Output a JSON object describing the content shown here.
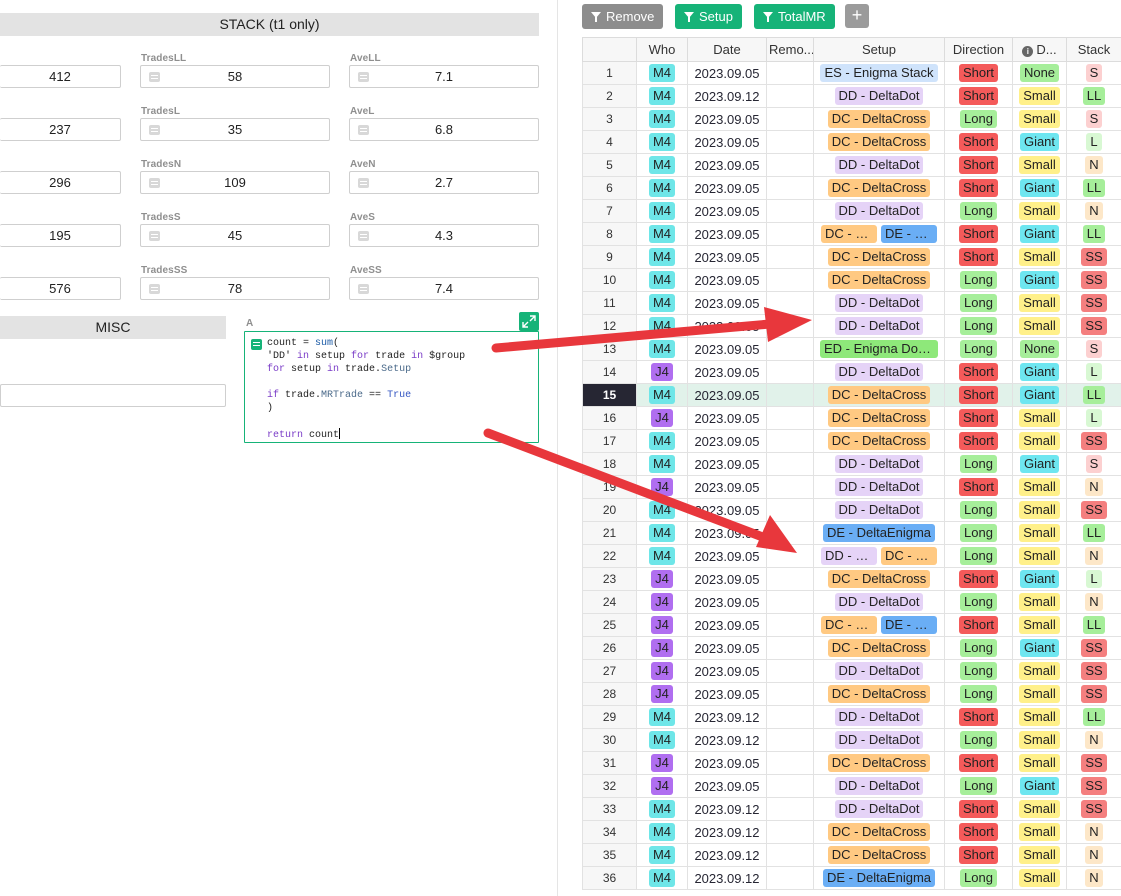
{
  "stack_section": {
    "title": "STACK   (t1 only)",
    "left_values": [
      "412",
      "237",
      "296",
      "195",
      "576"
    ],
    "fields": [
      {
        "label": "TradesLL",
        "value": "58"
      },
      {
        "label": "AveLL",
        "value": "7.1"
      },
      {
        "label": "TradesL",
        "value": "35"
      },
      {
        "label": "AveL",
        "value": "6.8"
      },
      {
        "label": "TradesN",
        "value": "109"
      },
      {
        "label": "AveN",
        "value": "2.7"
      },
      {
        "label": "TradesS",
        "value": "45"
      },
      {
        "label": "AveS",
        "value": "4.3"
      },
      {
        "label": "TradesSS",
        "value": "78"
      },
      {
        "label": "AveSS",
        "value": "7.4"
      }
    ]
  },
  "misc_section": {
    "title": "MISC"
  },
  "formula_editor": {
    "column_label": "A",
    "code": "count = sum(\n'DD' in setup for trade in $group\nfor setup in trade.Setup\n\nif trade.MRTrade == True\n)\n\nreturn count"
  },
  "filters": [
    {
      "label": "Remove",
      "color": "#8d8d8d"
    },
    {
      "label": "Setup",
      "color": "#16b378"
    },
    {
      "label": "TotalMR",
      "color": "#16b378"
    }
  ],
  "grid": {
    "columns": [
      "",
      "Who",
      "Date",
      "Remo...",
      "Setup",
      "Direction",
      "D...",
      "Stack"
    ],
    "selected_row": 15,
    "chip_colors": {
      "M4": "#6ee6e8",
      "J4": "#b06ef0",
      "ES": "#cfe3fb",
      "DD": "#e5d3f7",
      "DC": "#ffc982",
      "DE": "#6aaef5",
      "ED": "#8ee87a",
      "Short": "#f45a5a",
      "Long": "#a6ee9a",
      "None": "#a6ee9a",
      "Small": "#fff08a",
      "Giant": "#6ee6f0",
      "S": "#fcd0d0",
      "LL": "#a6ee9a",
      "N": "#fde7c8",
      "L": "#d8f8d3",
      "SS": "#f47f7f"
    },
    "rows": [
      {
        "n": "1",
        "who": "M4",
        "date": "2023.09.05",
        "setup": [
          {
            "k": "ES",
            "t": "ES - Enigma Stack"
          }
        ],
        "dir": "Short",
        "d": "None",
        "stack": "S"
      },
      {
        "n": "2",
        "who": "M4",
        "date": "2023.09.12",
        "setup": [
          {
            "k": "DD",
            "t": "DD - DeltaDot"
          }
        ],
        "dir": "Short",
        "d": "Small",
        "stack": "LL"
      },
      {
        "n": "3",
        "who": "M4",
        "date": "2023.09.05",
        "setup": [
          {
            "k": "DC",
            "t": "DC - DeltaCross"
          }
        ],
        "dir": "Long",
        "d": "Small",
        "stack": "S"
      },
      {
        "n": "4",
        "who": "M4",
        "date": "2023.09.05",
        "setup": [
          {
            "k": "DC",
            "t": "DC - DeltaCross"
          }
        ],
        "dir": "Short",
        "d": "Giant",
        "stack": "L"
      },
      {
        "n": "5",
        "who": "M4",
        "date": "2023.09.05",
        "setup": [
          {
            "k": "DD",
            "t": "DD - DeltaDot"
          }
        ],
        "dir": "Short",
        "d": "Small",
        "stack": "N"
      },
      {
        "n": "6",
        "who": "M4",
        "date": "2023.09.05",
        "setup": [
          {
            "k": "DC",
            "t": "DC - DeltaCross"
          }
        ],
        "dir": "Short",
        "d": "Giant",
        "stack": "LL"
      },
      {
        "n": "7",
        "who": "M4",
        "date": "2023.09.05",
        "setup": [
          {
            "k": "DD",
            "t": "DD - DeltaDot"
          }
        ],
        "dir": "Long",
        "d": "Small",
        "stack": "N"
      },
      {
        "n": "8",
        "who": "M4",
        "date": "2023.09.05",
        "setup": [
          {
            "k": "DC",
            "t": "DC - DeltaCross"
          },
          {
            "k": "DE",
            "t": "DE - DeltaEnigma"
          }
        ],
        "dir": "Short",
        "d": "Giant",
        "stack": "LL"
      },
      {
        "n": "9",
        "who": "M4",
        "date": "2023.09.05",
        "setup": [
          {
            "k": "DC",
            "t": "DC - DeltaCross"
          }
        ],
        "dir": "Short",
        "d": "Small",
        "stack": "SS"
      },
      {
        "n": "10",
        "who": "M4",
        "date": "2023.09.05",
        "setup": [
          {
            "k": "DC",
            "t": "DC - DeltaCross"
          }
        ],
        "dir": "Long",
        "d": "Giant",
        "stack": "SS"
      },
      {
        "n": "11",
        "who": "M4",
        "date": "2023.09.05",
        "setup": [
          {
            "k": "DD",
            "t": "DD - DeltaDot"
          }
        ],
        "dir": "Long",
        "d": "Small",
        "stack": "SS"
      },
      {
        "n": "12",
        "who": "M4",
        "date": "2023.09.05",
        "setup": [
          {
            "k": "DD",
            "t": "DD - DeltaDot"
          }
        ],
        "dir": "Long",
        "d": "Small",
        "stack": "SS"
      },
      {
        "n": "13",
        "who": "M4",
        "date": "2023.09.05",
        "setup": [
          {
            "k": "ED",
            "t": "ED - Enigma DotCross"
          }
        ],
        "dir": "Long",
        "d": "None",
        "stack": "S"
      },
      {
        "n": "14",
        "who": "J4",
        "date": "2023.09.05",
        "setup": [
          {
            "k": "DD",
            "t": "DD - DeltaDot"
          }
        ],
        "dir": "Short",
        "d": "Giant",
        "stack": "L"
      },
      {
        "n": "15",
        "who": "M4",
        "date": "2023.09.05",
        "setup": [
          {
            "k": "DC",
            "t": "DC - DeltaCross"
          }
        ],
        "dir": "Short",
        "d": "Giant",
        "stack": "LL"
      },
      {
        "n": "16",
        "who": "J4",
        "date": "2023.09.05",
        "setup": [
          {
            "k": "DC",
            "t": "DC - DeltaCross"
          }
        ],
        "dir": "Short",
        "d": "Small",
        "stack": "L"
      },
      {
        "n": "17",
        "who": "M4",
        "date": "2023.09.05",
        "setup": [
          {
            "k": "DC",
            "t": "DC - DeltaCross"
          }
        ],
        "dir": "Short",
        "d": "Small",
        "stack": "SS"
      },
      {
        "n": "18",
        "who": "M4",
        "date": "2023.09.05",
        "setup": [
          {
            "k": "DD",
            "t": "DD - DeltaDot"
          }
        ],
        "dir": "Long",
        "d": "Giant",
        "stack": "S"
      },
      {
        "n": "19",
        "who": "J4",
        "date": "2023.09.05",
        "setup": [
          {
            "k": "DD",
            "t": "DD - DeltaDot"
          }
        ],
        "dir": "Short",
        "d": "Small",
        "stack": "N"
      },
      {
        "n": "20",
        "who": "M4",
        "date": "2023.09.05",
        "setup": [
          {
            "k": "DD",
            "t": "DD - DeltaDot"
          }
        ],
        "dir": "Long",
        "d": "Small",
        "stack": "SS"
      },
      {
        "n": "21",
        "who": "M4",
        "date": "2023.09.05",
        "setup": [
          {
            "k": "DE",
            "t": "DE - DeltaEnigma"
          }
        ],
        "dir": "Long",
        "d": "Small",
        "stack": "LL"
      },
      {
        "n": "22",
        "who": "M4",
        "date": "2023.09.05",
        "setup": [
          {
            "k": "DD",
            "t": "DD - DeltaDot"
          },
          {
            "k": "DC",
            "t": "DC - DeltaCross"
          }
        ],
        "dir": "Long",
        "d": "Small",
        "stack": "N"
      },
      {
        "n": "23",
        "who": "J4",
        "date": "2023.09.05",
        "setup": [
          {
            "k": "DC",
            "t": "DC - DeltaCross"
          }
        ],
        "dir": "Short",
        "d": "Giant",
        "stack": "L"
      },
      {
        "n": "24",
        "who": "J4",
        "date": "2023.09.05",
        "setup": [
          {
            "k": "DD",
            "t": "DD - DeltaDot"
          }
        ],
        "dir": "Long",
        "d": "Small",
        "stack": "N"
      },
      {
        "n": "25",
        "who": "J4",
        "date": "2023.09.05",
        "setup": [
          {
            "k": "DC",
            "t": "DC - DeltaCross"
          },
          {
            "k": "DE",
            "t": "DE - DeltaEnigma"
          }
        ],
        "dir": "Short",
        "d": "Small",
        "stack": "LL"
      },
      {
        "n": "26",
        "who": "J4",
        "date": "2023.09.05",
        "setup": [
          {
            "k": "DC",
            "t": "DC - DeltaCross"
          }
        ],
        "dir": "Long",
        "d": "Giant",
        "stack": "SS"
      },
      {
        "n": "27",
        "who": "J4",
        "date": "2023.09.05",
        "setup": [
          {
            "k": "DD",
            "t": "DD - DeltaDot"
          }
        ],
        "dir": "Long",
        "d": "Small",
        "stack": "SS"
      },
      {
        "n": "28",
        "who": "J4",
        "date": "2023.09.05",
        "setup": [
          {
            "k": "DC",
            "t": "DC - DeltaCross"
          }
        ],
        "dir": "Long",
        "d": "Small",
        "stack": "SS"
      },
      {
        "n": "29",
        "who": "M4",
        "date": "2023.09.12",
        "setup": [
          {
            "k": "DD",
            "t": "DD - DeltaDot"
          }
        ],
        "dir": "Short",
        "d": "Small",
        "stack": "LL"
      },
      {
        "n": "30",
        "who": "M4",
        "date": "2023.09.12",
        "setup": [
          {
            "k": "DD",
            "t": "DD - DeltaDot"
          }
        ],
        "dir": "Long",
        "d": "Small",
        "stack": "N"
      },
      {
        "n": "31",
        "who": "J4",
        "date": "2023.09.05",
        "setup": [
          {
            "k": "DC",
            "t": "DC - DeltaCross"
          }
        ],
        "dir": "Short",
        "d": "Small",
        "stack": "SS"
      },
      {
        "n": "32",
        "who": "J4",
        "date": "2023.09.05",
        "setup": [
          {
            "k": "DD",
            "t": "DD - DeltaDot"
          }
        ],
        "dir": "Long",
        "d": "Giant",
        "stack": "SS"
      },
      {
        "n": "33",
        "who": "M4",
        "date": "2023.09.12",
        "setup": [
          {
            "k": "DD",
            "t": "DD - DeltaDot"
          }
        ],
        "dir": "Short",
        "d": "Small",
        "stack": "SS"
      },
      {
        "n": "34",
        "who": "M4",
        "date": "2023.09.12",
        "setup": [
          {
            "k": "DC",
            "t": "DC - DeltaCross"
          }
        ],
        "dir": "Short",
        "d": "Small",
        "stack": "N"
      },
      {
        "n": "35",
        "who": "M4",
        "date": "2023.09.12",
        "setup": [
          {
            "k": "DC",
            "t": "DC - DeltaCross"
          }
        ],
        "dir": "Short",
        "d": "Small",
        "stack": "N"
      },
      {
        "n": "36",
        "who": "M4",
        "date": "2023.09.12",
        "setup": [
          {
            "k": "DE",
            "t": "DE - DeltaEnigma"
          }
        ],
        "dir": "Long",
        "d": "Small",
        "stack": "N"
      }
    ]
  },
  "annotation_color": "#e8373c"
}
